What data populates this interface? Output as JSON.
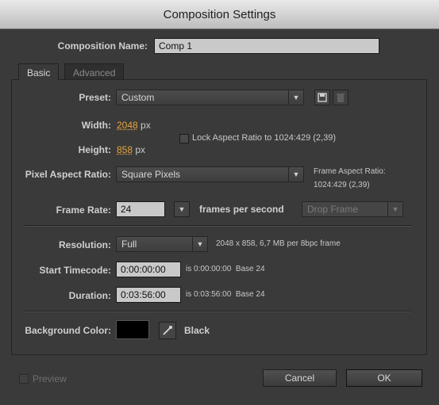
{
  "window": {
    "title": "Composition Settings"
  },
  "comp_name": {
    "label": "Composition Name:",
    "value": "Comp 1"
  },
  "tabs": [
    {
      "label": "Basic"
    },
    {
      "label": "Advanced"
    }
  ],
  "preset": {
    "label": "Preset:",
    "value": "Custom"
  },
  "width": {
    "label": "Width:",
    "value": "2048",
    "unit": "px"
  },
  "height": {
    "label": "Height:",
    "value": "858",
    "unit": "px"
  },
  "lock_aspect": {
    "label": "Lock Aspect Ratio to 1024:429 (2,39)",
    "checked": false
  },
  "pixel_aspect": {
    "label": "Pixel Aspect Ratio:",
    "value": "Square Pixels"
  },
  "frame_aspect": {
    "label": "Frame Aspect Ratio:",
    "value": "1024:429 (2,39)"
  },
  "frame_rate": {
    "label": "Frame Rate:",
    "value": "24",
    "unit": "frames per second",
    "drop_frame": "Drop Frame"
  },
  "resolution": {
    "label": "Resolution:",
    "value": "Full",
    "info": "2048 x 858, 6,7 MB per 8bpc frame"
  },
  "start_timecode": {
    "label": "Start Timecode:",
    "value": "0:00:00:00",
    "info": "is 0:00:00:00  Base 24"
  },
  "duration": {
    "label": "Duration:",
    "value": "0:03:56:00",
    "info": "is 0:03:56:00  Base 24"
  },
  "background": {
    "label": "Background Color:",
    "color": "#000000",
    "name": "Black"
  },
  "footer": {
    "preview": "Preview",
    "cancel": "Cancel",
    "ok": "OK"
  },
  "colors": {
    "accent": "#e8a33b",
    "bg": "#3a3a3a"
  }
}
